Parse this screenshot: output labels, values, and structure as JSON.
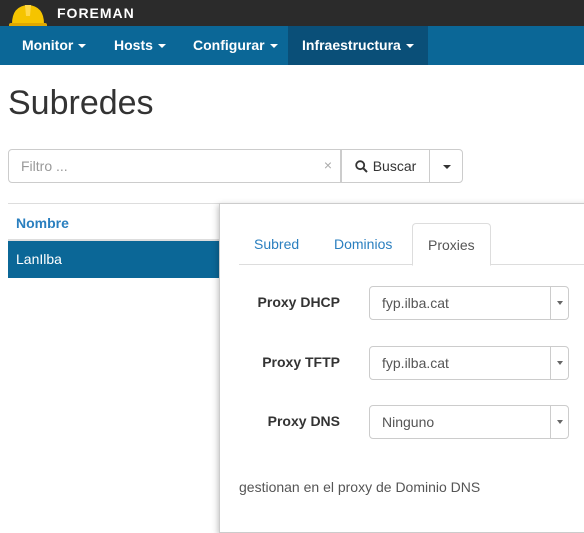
{
  "topbar": {
    "brand": "FOREMAN",
    "logo": "foreman-helmet-icon"
  },
  "navbar": {
    "items": [
      {
        "label": "Monitor"
      },
      {
        "label": "Hosts"
      },
      {
        "label": "Configurar"
      },
      {
        "label": "Infraestructura"
      }
    ],
    "active_index": 3
  },
  "page": {
    "title": "Subredes"
  },
  "search": {
    "placeholder": "Filtro ...",
    "value": "",
    "clear_symbol": "×",
    "button_label": "Buscar",
    "search_icon": "search-icon"
  },
  "list": {
    "header": "Nombre",
    "rows": [
      {
        "name": "LanIlba"
      }
    ]
  },
  "panel": {
    "tabs": [
      {
        "label": "Subred"
      },
      {
        "label": "Dominios"
      },
      {
        "label": "Proxies"
      }
    ],
    "active_tab": "Proxies",
    "fields": [
      {
        "label": "Proxy DHCP",
        "value": "fyp.ilba.cat"
      },
      {
        "label": "Proxy TFTP",
        "value": "fyp.ilba.cat"
      },
      {
        "label": "Proxy DNS",
        "value": "Ninguno"
      }
    ],
    "help_text": "gestionan en el proxy de Dominio DNS"
  },
  "colors": {
    "topbar": "#2b2b2b",
    "navbar": "#0b6797",
    "nav_active": "#0a4f78",
    "link": "#2a7fbf",
    "selected_row": "#0b6797",
    "logo_yellow": "#f5c400"
  }
}
